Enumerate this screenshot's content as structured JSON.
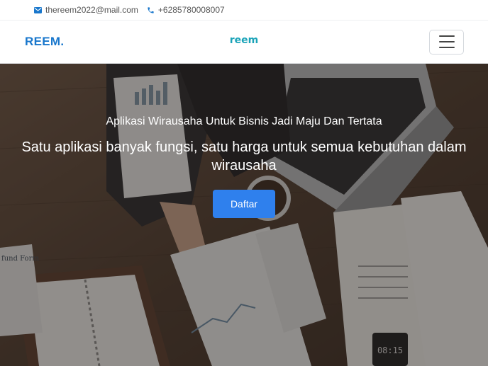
{
  "topbar": {
    "email": "thereem2022@mail.com",
    "phone": "+6285780008007"
  },
  "navbar": {
    "brand": "REEM.",
    "logo_text": "reem",
    "menu_icon": "hamburger-menu-icon"
  },
  "hero": {
    "kicker": "Aplikasi Wirausaha Untuk Bisnis Jadi Maju Dan Tertata",
    "headline": "Satu aplikasi banyak fungsi, satu harga untuk semua kebutuhan dalam wirausaha",
    "cta_label": "Daftar",
    "photo_text": {
      "form_tab": "fund Form",
      "clock": "08:15"
    }
  },
  "colors": {
    "brand": "#1977cc",
    "logo": "#1aa3b8",
    "cta": "#2f80ed",
    "icon": "#1977cc"
  }
}
